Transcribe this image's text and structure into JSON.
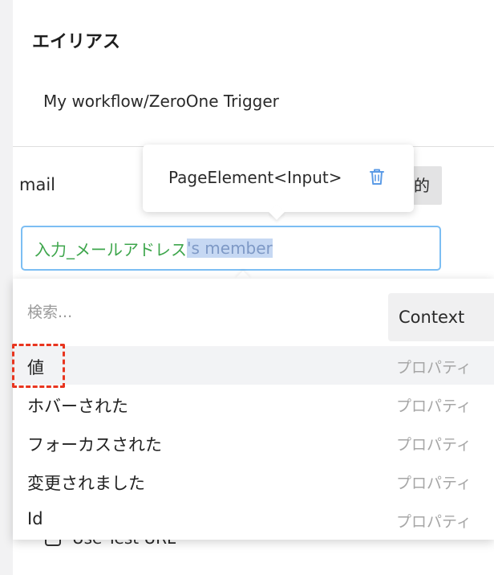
{
  "alias": {
    "title": "エイリアス",
    "value": "My workflow/ZeroOne Trigger"
  },
  "field": {
    "label": "mail",
    "static_chip": "的"
  },
  "expression": {
    "token": "入力_メールアドレス",
    "selected_suffix": "'s member"
  },
  "tooltip": {
    "type_label": "PageElement<Input>",
    "icon": "trash-icon"
  },
  "dropdown": {
    "search_placeholder": "検索...",
    "search_value": "",
    "context_tab": "Context",
    "items": [
      {
        "label": "値",
        "kind": "プロパティ",
        "highlighted": true
      },
      {
        "label": "ホバーされた",
        "kind": "プロパティ"
      },
      {
        "label": "フォーカスされた",
        "kind": "プロパティ"
      },
      {
        "label": "変更されました",
        "kind": "プロパティ"
      },
      {
        "label": "Id",
        "kind": "プロパティ"
      }
    ]
  },
  "checkbox": {
    "label": "Use Test URL",
    "checked": false
  },
  "colors": {
    "token_green": "#3ea64c",
    "input_border": "#7cbef3",
    "annotation_red": "#e8351f",
    "icon_blue": "#5b9be6"
  }
}
